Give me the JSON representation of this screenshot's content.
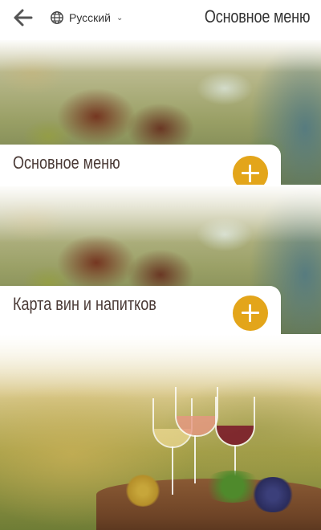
{
  "header": {
    "back_icon": "arrow-left-icon",
    "language": {
      "icon": "globe-icon",
      "label": "Русский",
      "chevron": "chevron-down-icon"
    },
    "title": "Основное меню"
  },
  "menu_cards": [
    {
      "label": "Основное меню",
      "image": "food-plate"
    },
    {
      "label": "Карта вин и напитков",
      "image": "food-plate"
    },
    {
      "label": "",
      "image": "wine-glasses-barrel"
    }
  ],
  "colors": {
    "accent": "#e3a51a",
    "text": "#4a3a36"
  }
}
